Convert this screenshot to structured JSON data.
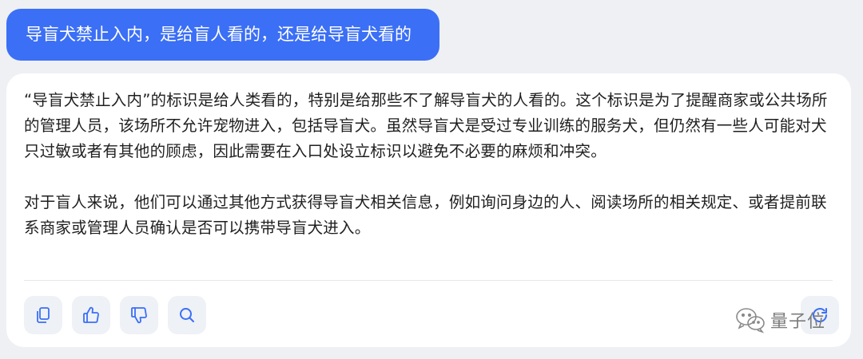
{
  "conversation": {
    "user_message": "导盲犬禁止入内，是给盲人看的，还是给导盲犬看的",
    "assistant_response": {
      "paragraphs": [
        "“导盲犬禁止入内”的标识是给人类看的，特别是给那些不了解导盲犬的人看的。这个标识是为了提醒商家或公共场所的管理人员，该场所不允许宠物进入，包括导盲犬。虽然导盲犬是受过专业训练的服务犬，但仍然有一些人可能对犬只过敏或者有其他的顾虑，因此需要在入口处设立标识以避免不必要的麻烦和冲突。",
        "对于盲人来说，他们可以通过其他方式获得导盲犬相关信息，例如询问身边的人、阅读场所的相关规定、或者提前联系商家或管理人员确认是否可以携带导盲犬进入。"
      ]
    }
  },
  "actions": [
    {
      "icon": "copy-icon"
    },
    {
      "icon": "thumbs-up-icon"
    },
    {
      "icon": "thumbs-down-icon"
    },
    {
      "icon": "search-icon"
    }
  ],
  "refresh": {
    "icon": "refresh-icon"
  },
  "watermark": {
    "text": "量子位",
    "icon": "wechat-icon"
  },
  "colors": {
    "accent": "#3b6ff5",
    "icon": "#3b6ff5",
    "background": "#eef0f4",
    "card": "#ffffff",
    "button_bg": "#eef1f6"
  }
}
